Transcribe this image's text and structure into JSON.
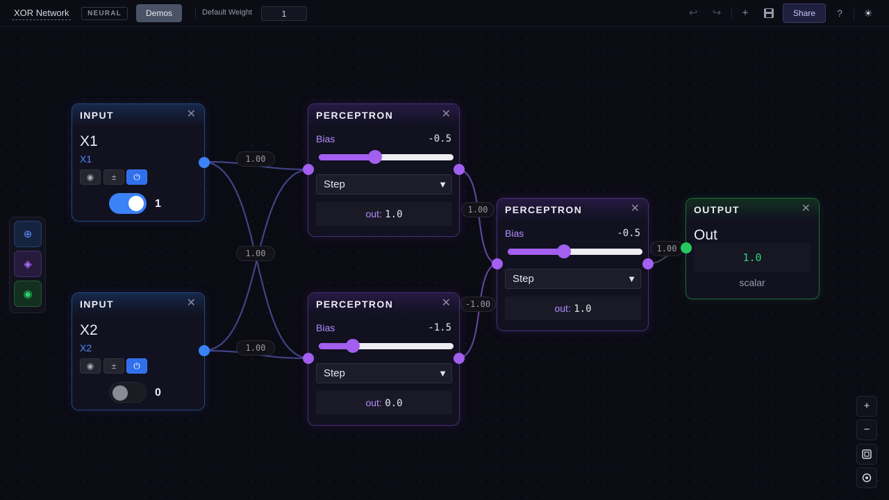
{
  "topbar": {
    "project_title": "XOR Network",
    "mode_badge": "NEURAL",
    "demos_label": "Demos",
    "default_weight_label": "Default Weight",
    "default_weight_value": "1",
    "share_label": "Share",
    "icons": [
      "undo-icon",
      "redo-icon",
      "plus-icon",
      "save-icon",
      "help-icon",
      "theme-sun-icon"
    ]
  },
  "palette": {
    "items": [
      {
        "name": "input",
        "glyph": "⊕",
        "color": "#5b8dff"
      },
      {
        "name": "perceptron",
        "glyph": "◈",
        "color": "#b070ff"
      },
      {
        "name": "output",
        "glyph": "◉",
        "color": "#28d16a"
      }
    ]
  },
  "nodes": {
    "input1": {
      "title": "INPUT",
      "name": "X1",
      "label": "X1",
      "tools": [
        "◉",
        "±",
        "⏻"
      ],
      "toggle_on": true,
      "value": "1"
    },
    "input2": {
      "title": "INPUT",
      "name": "X2",
      "label": "X2",
      "tools": [
        "◉",
        "±",
        "⏻"
      ],
      "toggle_on": false,
      "value": "0"
    },
    "perc1": {
      "title": "PERCEPTRON",
      "bias_label": "Bias",
      "bias": "-0.5",
      "bias_value": -0.5,
      "activation": "Step",
      "out_label": "out:",
      "out_value": "1.0"
    },
    "perc2": {
      "title": "PERCEPTRON",
      "bias_label": "Bias",
      "bias": "-1.5",
      "bias_value": -1.5,
      "activation": "Step",
      "out_label": "out:",
      "out_value": "0.0"
    },
    "perc3": {
      "title": "PERCEPTRON",
      "bias_label": "Bias",
      "bias": "-0.5",
      "bias_value": -0.5,
      "activation": "Step",
      "out_label": "out:",
      "out_value": "1.0"
    },
    "output": {
      "title": "OUTPUT",
      "name": "Out",
      "value": "1.0",
      "type": "scalar"
    }
  },
  "bias_range": [
    -3,
    3
  ],
  "wires": {
    "w1": "1.00",
    "w2": "1.00",
    "w3": "1.00",
    "w4": "1.00",
    "w5": "-1.00",
    "w6": "1.00"
  },
  "colors": {
    "input_accent": "#3b82f6",
    "perceptron_accent": "#a35ff0",
    "output_accent": "#28c760"
  },
  "zoom_controls": [
    "zoom-in-icon",
    "zoom-out-icon",
    "fit-view-icon",
    "center-icon"
  ]
}
